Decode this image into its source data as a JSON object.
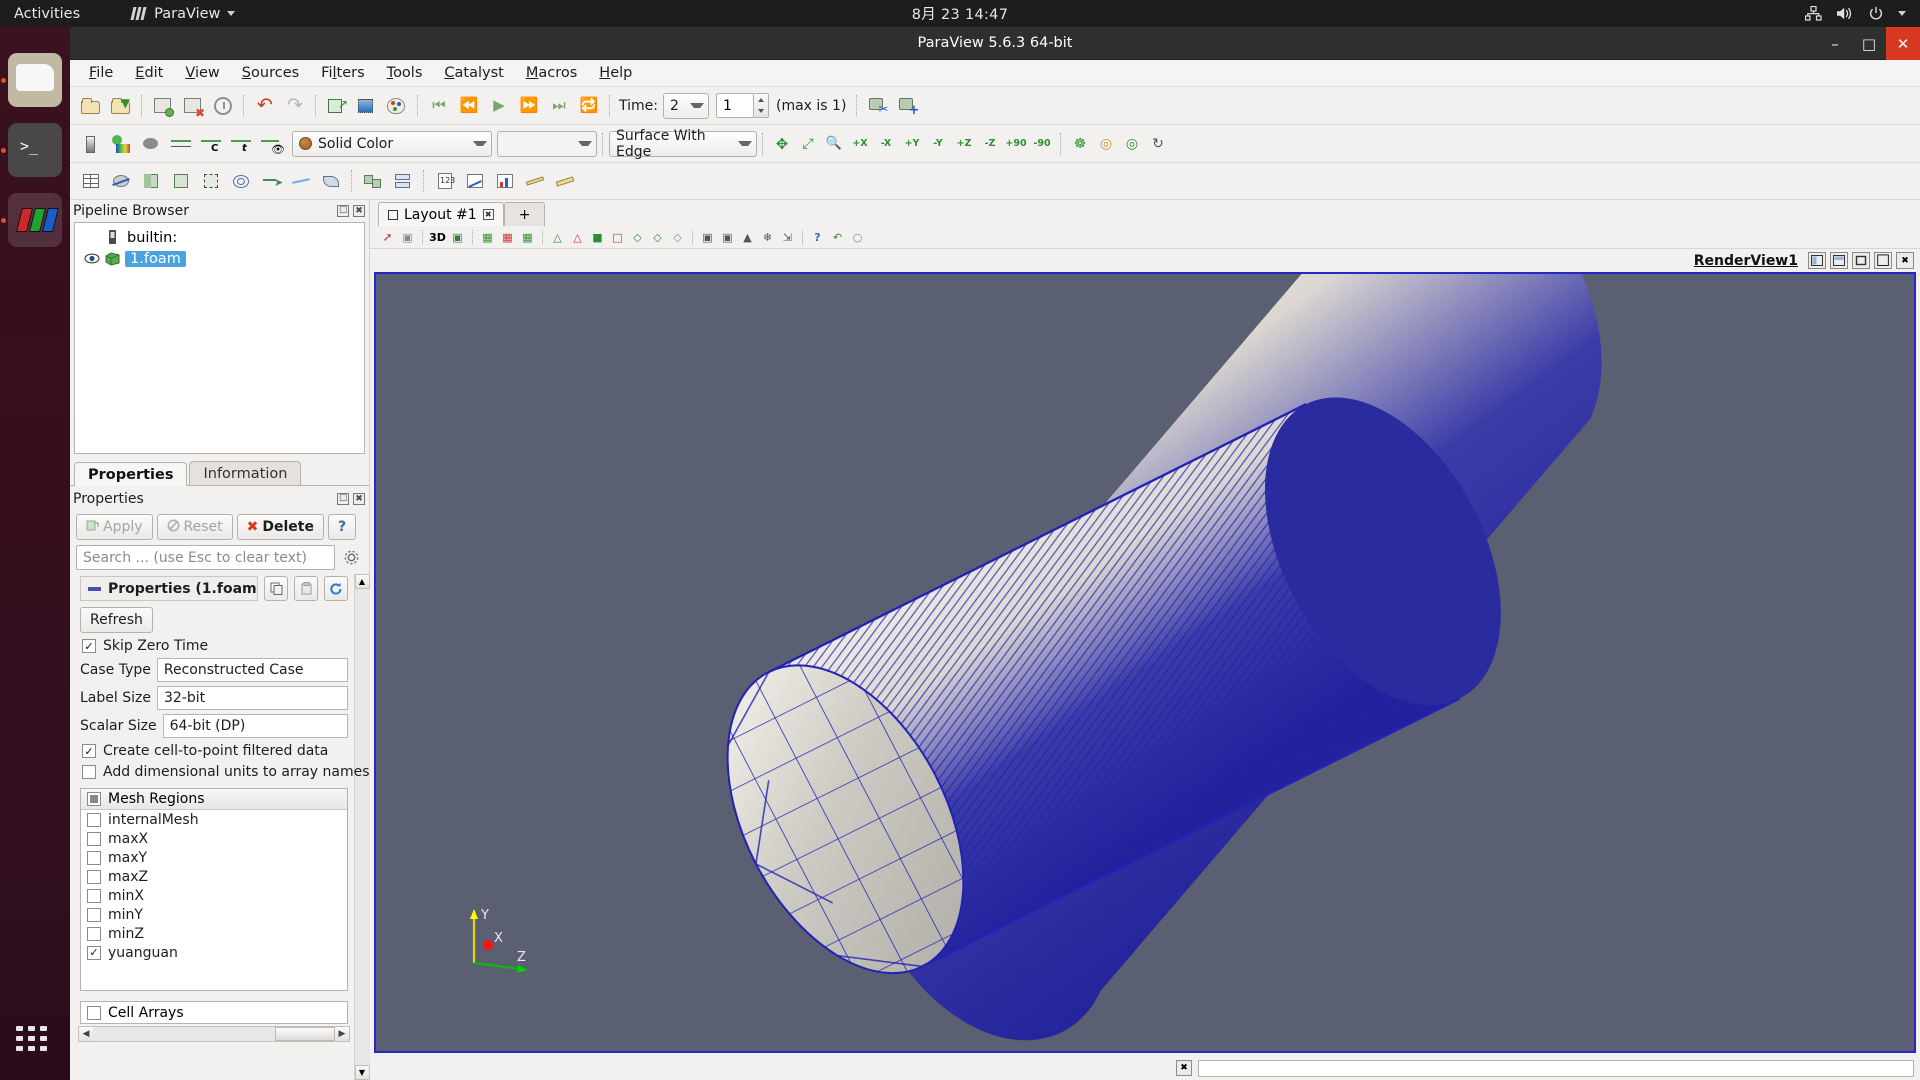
{
  "gnome": {
    "activities": "Activities",
    "app_name": "ParaView",
    "clock": "8月 23  14:47",
    "tray_icons": [
      "network-icon",
      "volume-icon",
      "power-icon",
      "chevron-down-icon"
    ]
  },
  "dock": {
    "items": [
      {
        "name": "files-icon",
        "label": "Files"
      },
      {
        "name": "terminal-icon",
        "label": "Terminal"
      },
      {
        "name": "paraview-icon",
        "label": "ParaView"
      }
    ],
    "show_apps": "Show Applications"
  },
  "window": {
    "title": "ParaView 5.6.3 64-bit",
    "minimize": "–",
    "maximize": "□",
    "close": "✕"
  },
  "menu": {
    "items": [
      {
        "pre": "",
        "hot": "F",
        "post": "ile"
      },
      {
        "pre": "",
        "hot": "E",
        "post": "dit"
      },
      {
        "pre": "",
        "hot": "V",
        "post": "iew"
      },
      {
        "pre": "",
        "hot": "S",
        "post": "ources"
      },
      {
        "pre": "Fi",
        "hot": "l",
        "post": "ters"
      },
      {
        "pre": "",
        "hot": "T",
        "post": "ools"
      },
      {
        "pre": "",
        "hot": "C",
        "post": "atalyst"
      },
      {
        "pre": "",
        "hot": "M",
        "post": "acros"
      },
      {
        "pre": "",
        "hot": "H",
        "post": "elp"
      }
    ]
  },
  "toolbar_main": {
    "buttons": [
      "open-file-icon",
      "recent-files-icon",
      "save-state-icon",
      "load-state-icon",
      "reset-session-icon",
      "undo-icon",
      "redo-icon",
      "undo-camera-icon",
      "redo-camera-icon",
      "color-palette-icon"
    ],
    "vcr": {
      "first_frame": "first-frame-icon",
      "previous_frame": "previous-frame-icon",
      "play": "play-icon",
      "next_frame": "next-frame-icon",
      "last_frame": "last-frame-icon",
      "loop": "loop-icon"
    },
    "time_label": "Time:",
    "time_value": "2",
    "frame_value": "1",
    "max_label": "(max is 1)",
    "extra_buttons": [
      "camera-link-icon",
      "add-camera-icon"
    ]
  },
  "toolbar_repr": {
    "left_buttons": [
      "scalar-bar-icon",
      "edit-color-map-icon",
      "rescale-data-range-icon",
      "rescale-custom-icon",
      "rescale-temporal-icon",
      "rescale-visible-icon"
    ],
    "color_by": "Solid Color",
    "color_by_icon": "solid-color-swatch",
    "array_component": "",
    "representation": "Surface With Edge",
    "camera_buttons": [
      "reset-camera-icon",
      "zoom-to-data-icon",
      "zoom-to-box-icon",
      "pos-x-icon",
      "neg-x-icon",
      "pos-y-icon",
      "neg-y-icon",
      "pos-z-icon",
      "neg-z-icon",
      "rotate-plus-90-icon",
      "rotate-minus-90-icon",
      "center-axes-icon",
      "show-center-icon",
      "pick-center-icon",
      "reset-center-icon"
    ],
    "axis_labels": [
      "+X",
      "-X",
      "+Y",
      "-Y",
      "+Z",
      "-Z",
      "+90",
      "-90"
    ]
  },
  "toolbar_filters": {
    "buttons": [
      "spreadsheet-icon",
      "slice-icon",
      "clip-icon",
      "threshold-icon",
      "extract-subset-icon",
      "contour-icon",
      "glyph-icon",
      "stream-tracer-icon",
      "warp-icon",
      "group-datasets-icon",
      "extract-level-icon",
      "calculator-icon",
      "plot-over-line-icon",
      "plot-selection-icon",
      "measure-icon",
      "ruler-icon"
    ]
  },
  "pipeline": {
    "title": "Pipeline Browser",
    "undock_icon": "undock-icon",
    "close_icon": "close-icon",
    "nodes": [
      {
        "label": "builtin:",
        "icon": "server-icon",
        "selected": false,
        "eye": false
      },
      {
        "label": "1.foam",
        "icon": "dataset-icon",
        "selected": true,
        "eye": true
      }
    ]
  },
  "properties_panel": {
    "tabs": [
      {
        "label": "Properties",
        "active": true
      },
      {
        "label": "Information",
        "active": false
      }
    ],
    "title": "Properties",
    "undock_icon": "undock-icon",
    "close_icon": "close-icon",
    "buttons": {
      "apply": "Apply",
      "reset": "Reset",
      "delete": "Delete",
      "help": "?"
    },
    "search_placeholder": "Search ... (use Esc to clear text)",
    "gear_icon": "gear-icon",
    "group_title": "Properties (1.foam",
    "group_buttons": [
      "copy-icon",
      "paste-icon",
      "restore-defaults-icon"
    ],
    "refresh_button": "Refresh",
    "skip_zero_time": {
      "label": "Skip Zero Time",
      "checked": true
    },
    "case_type": {
      "label": "Case Type",
      "value": "Reconstructed Case"
    },
    "label_size": {
      "label": "Label Size",
      "value": "32-bit"
    },
    "scalar_size": {
      "label": "Scalar Size",
      "value": "64-bit (DP)"
    },
    "cell_to_point": {
      "label": "Create cell-to-point filtered data",
      "checked": true
    },
    "dimensional_units": {
      "label": "Add dimensional units to array names",
      "checked": false
    },
    "mesh_regions": {
      "header": "Mesh Regions",
      "header_state": "partial",
      "items": [
        {
          "label": "internalMesh",
          "checked": false
        },
        {
          "label": "maxX",
          "checked": false
        },
        {
          "label": "maxY",
          "checked": false
        },
        {
          "label": "maxZ",
          "checked": false
        },
        {
          "label": "minX",
          "checked": false
        },
        {
          "label": "minY",
          "checked": false
        },
        {
          "label": "minZ",
          "checked": false
        },
        {
          "label": "yuanguan",
          "checked": true
        }
      ]
    },
    "cell_arrays": {
      "label": "Cell Arrays",
      "checked": false
    }
  },
  "layout": {
    "tab_label": "Layout #1",
    "tab_close": "✕",
    "add_tab": "+",
    "view_toolbar_buttons": [
      "interact-icon",
      "select-cells-icon",
      "3D",
      "camera-icon",
      "select-points-on-icon",
      "select-cells-through-icon",
      "select-points-through-icon",
      "frustum-cells-icon",
      "frustum-points-icon",
      "select-block-icon",
      "interactive-select-icon",
      "hover-cells-icon",
      "hover-points-icon",
      "clear-selection-icon",
      "grow-selection-icon",
      "shrink-selection-icon",
      "plot-selection-icon",
      "freeze-selection-icon",
      "extract-selection-icon",
      "help-icon",
      "undo-selection-icon",
      "redo-selection-icon"
    ],
    "view_toolbar_3d_label": "3D"
  },
  "render_view": {
    "name": "RenderView1",
    "header_buttons": [
      "split-horizontal-icon",
      "split-vertical-icon",
      "maximize-icon",
      "undock-icon",
      "close-icon"
    ],
    "background_color": "#5b5f72",
    "border_color": "#2727c8",
    "surface_color": "#cdc9c4",
    "edge_color": "#2020b0",
    "axes": [
      {
        "label": "X",
        "color": "#ff0000"
      },
      {
        "label": "Y",
        "color": "#ffff00"
      },
      {
        "label": "Z",
        "color": "#00cc00"
      }
    ]
  },
  "statusbar": {
    "cancel_icon": "cancel-icon",
    "progress_text": ""
  }
}
